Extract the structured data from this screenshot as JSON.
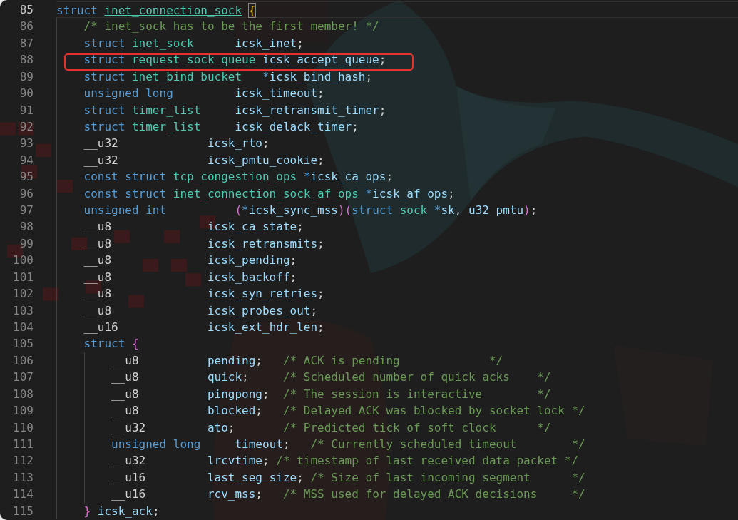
{
  "editor": {
    "lines": [
      {
        "number": "85",
        "current": true,
        "highlighted": false,
        "tokens": [
          {
            "text": "struct",
            "kind": "keyword"
          },
          {
            "text": " inet_connection_sock",
            "kind": "link"
          },
          {
            "text": " {",
            "kind": "bracket-match"
          }
        ]
      },
      {
        "number": "86",
        "current": false,
        "highlighted": false,
        "tokens": [
          {
            "text": "    /* inet_sock has to be the first member! */",
            "kind": "comment"
          }
        ]
      },
      {
        "number": "87",
        "current": false,
        "highlighted": false,
        "tokens": [
          {
            "text": "    struct",
            "kind": "keyword"
          },
          {
            "text": " inet_sock",
            "kind": "type"
          },
          {
            "text": "      icsk_inet",
            "kind": "variable"
          },
          {
            "text": ";",
            "kind": "plain"
          }
        ]
      },
      {
        "number": "88",
        "current": false,
        "highlighted": true,
        "tokens": [
          {
            "text": "    struct",
            "kind": "keyword"
          },
          {
            "text": " request_sock_queue",
            "kind": "type"
          },
          {
            "text": " icsk_accept_queue",
            "kind": "variable"
          },
          {
            "text": ";",
            "kind": "plain"
          }
        ]
      },
      {
        "number": "89",
        "current": false,
        "highlighted": false,
        "tokens": [
          {
            "text": "    struct",
            "kind": "keyword"
          },
          {
            "text": " inet_bind_bucket",
            "kind": "type"
          },
          {
            "text": "   *",
            "kind": "keyword"
          },
          {
            "text": "icsk_bind_hash",
            "kind": "variable"
          },
          {
            "text": ";",
            "kind": "plain"
          }
        ]
      },
      {
        "number": "90",
        "current": false,
        "highlighted": false,
        "tokens": [
          {
            "text": "    unsigned long",
            "kind": "keyword"
          },
          {
            "text": "         icsk_timeout",
            "kind": "variable"
          },
          {
            "text": ";",
            "kind": "plain"
          }
        ]
      },
      {
        "number": "91",
        "current": false,
        "highlighted": false,
        "tokens": [
          {
            "text": "    struct",
            "kind": "keyword"
          },
          {
            "text": " timer_list",
            "kind": "type"
          },
          {
            "text": "     icsk_retransmit_timer",
            "kind": "variable"
          },
          {
            "text": ";",
            "kind": "plain"
          }
        ]
      },
      {
        "number": "92",
        "current": false,
        "highlighted": false,
        "tokens": [
          {
            "text": "    struct",
            "kind": "keyword"
          },
          {
            "text": " timer_list",
            "kind": "type"
          },
          {
            "text": "     icsk_delack_timer",
            "kind": "variable"
          },
          {
            "text": ";",
            "kind": "plain"
          }
        ]
      },
      {
        "number": "93",
        "current": false,
        "highlighted": false,
        "tokens": [
          {
            "text": "    __u32",
            "kind": "plain"
          },
          {
            "text": "             icsk_rto",
            "kind": "variable"
          },
          {
            "text": ";",
            "kind": "plain"
          }
        ]
      },
      {
        "number": "94",
        "current": false,
        "highlighted": false,
        "tokens": [
          {
            "text": "    __u32",
            "kind": "plain"
          },
          {
            "text": "             icsk_pmtu_cookie",
            "kind": "variable"
          },
          {
            "text": ";",
            "kind": "plain"
          }
        ]
      },
      {
        "number": "95",
        "current": false,
        "highlighted": false,
        "tokens": [
          {
            "text": "    const struct",
            "kind": "keyword"
          },
          {
            "text": " tcp_congestion_ops",
            "kind": "type"
          },
          {
            "text": " *",
            "kind": "keyword"
          },
          {
            "text": "icsk_ca_ops",
            "kind": "variable"
          },
          {
            "text": ";",
            "kind": "plain"
          }
        ]
      },
      {
        "number": "96",
        "current": false,
        "highlighted": false,
        "tokens": [
          {
            "text": "    const struct",
            "kind": "keyword"
          },
          {
            "text": " inet_connection_sock_af_ops",
            "kind": "type"
          },
          {
            "text": " *",
            "kind": "keyword"
          },
          {
            "text": "icsk_af_ops",
            "kind": "variable"
          },
          {
            "text": ";",
            "kind": "plain"
          }
        ]
      },
      {
        "number": "97",
        "current": false,
        "highlighted": false,
        "tokens": [
          {
            "text": "    unsigned int",
            "kind": "keyword"
          },
          {
            "text": "          (",
            "kind": "bracket"
          },
          {
            "text": "*",
            "kind": "keyword"
          },
          {
            "text": "icsk_sync_mss",
            "kind": "variable"
          },
          {
            "text": ")(",
            "kind": "bracket"
          },
          {
            "text": "struct",
            "kind": "keyword"
          },
          {
            "text": " sock",
            "kind": "type"
          },
          {
            "text": " *",
            "kind": "keyword"
          },
          {
            "text": "sk",
            "kind": "variable"
          },
          {
            "text": ",",
            "kind": "plain"
          },
          {
            "text": " u32 pmtu",
            "kind": "variable"
          },
          {
            "text": ")",
            "kind": "bracket"
          },
          {
            "text": ";",
            "kind": "plain"
          }
        ]
      },
      {
        "number": "98",
        "current": false,
        "highlighted": false,
        "tokens": [
          {
            "text": "    __u8",
            "kind": "plain"
          },
          {
            "text": "              icsk_ca_state",
            "kind": "variable"
          },
          {
            "text": ";",
            "kind": "plain"
          }
        ]
      },
      {
        "number": "99",
        "current": false,
        "highlighted": false,
        "tokens": [
          {
            "text": "    __u8",
            "kind": "plain"
          },
          {
            "text": "              icsk_retransmits",
            "kind": "variable"
          },
          {
            "text": ";",
            "kind": "plain"
          }
        ]
      },
      {
        "number": "100",
        "current": false,
        "highlighted": false,
        "tokens": [
          {
            "text": "    __u8",
            "kind": "plain"
          },
          {
            "text": "              icsk_pending",
            "kind": "variable"
          },
          {
            "text": ";",
            "kind": "plain"
          }
        ]
      },
      {
        "number": "101",
        "current": false,
        "highlighted": false,
        "tokens": [
          {
            "text": "    __u8",
            "kind": "plain"
          },
          {
            "text": "              icsk_backoff",
            "kind": "variable"
          },
          {
            "text": ";",
            "kind": "plain"
          }
        ]
      },
      {
        "number": "102",
        "current": false,
        "highlighted": false,
        "tokens": [
          {
            "text": "    __u8",
            "kind": "plain"
          },
          {
            "text": "              icsk_syn_retries",
            "kind": "variable"
          },
          {
            "text": ";",
            "kind": "plain"
          }
        ]
      },
      {
        "number": "103",
        "current": false,
        "highlighted": false,
        "tokens": [
          {
            "text": "    __u8",
            "kind": "plain"
          },
          {
            "text": "              icsk_probes_out",
            "kind": "variable"
          },
          {
            "text": ";",
            "kind": "plain"
          }
        ]
      },
      {
        "number": "104",
        "current": false,
        "highlighted": false,
        "tokens": [
          {
            "text": "    __u16",
            "kind": "plain"
          },
          {
            "text": "             icsk_ext_hdr_len",
            "kind": "variable"
          },
          {
            "text": ";",
            "kind": "plain"
          }
        ]
      },
      {
        "number": "105",
        "current": false,
        "highlighted": false,
        "tokens": [
          {
            "text": "    struct",
            "kind": "keyword"
          },
          {
            "text": " {",
            "kind": "bracket"
          }
        ]
      },
      {
        "number": "106",
        "current": false,
        "highlighted": false,
        "tokens": [
          {
            "text": "        __u8",
            "kind": "plain"
          },
          {
            "text": "          pending",
            "kind": "variable"
          },
          {
            "text": ";",
            "kind": "plain"
          },
          {
            "text": "   /* ACK is pending             */",
            "kind": "comment"
          }
        ]
      },
      {
        "number": "107",
        "current": false,
        "highlighted": false,
        "tokens": [
          {
            "text": "        __u8",
            "kind": "plain"
          },
          {
            "text": "          quick",
            "kind": "variable"
          },
          {
            "text": ";",
            "kind": "plain"
          },
          {
            "text": "     /* Scheduled number of quick acks    */",
            "kind": "comment"
          }
        ]
      },
      {
        "number": "108",
        "current": false,
        "highlighted": false,
        "tokens": [
          {
            "text": "        __u8",
            "kind": "plain"
          },
          {
            "text": "          pingpong",
            "kind": "variable"
          },
          {
            "text": ";",
            "kind": "plain"
          },
          {
            "text": "  /* The session is interactive        */",
            "kind": "comment"
          }
        ]
      },
      {
        "number": "109",
        "current": false,
        "highlighted": false,
        "tokens": [
          {
            "text": "        __u8",
            "kind": "plain"
          },
          {
            "text": "          blocked",
            "kind": "variable"
          },
          {
            "text": ";",
            "kind": "plain"
          },
          {
            "text": "   /* Delayed ACK was blocked by socket lock */",
            "kind": "comment"
          }
        ]
      },
      {
        "number": "110",
        "current": false,
        "highlighted": false,
        "tokens": [
          {
            "text": "        __u32",
            "kind": "plain"
          },
          {
            "text": "         ato",
            "kind": "variable"
          },
          {
            "text": ";",
            "kind": "plain"
          },
          {
            "text": "       /* Predicted tick of soft clock      */",
            "kind": "comment"
          }
        ]
      },
      {
        "number": "111",
        "current": false,
        "highlighted": false,
        "tokens": [
          {
            "text": "        unsigned long",
            "kind": "keyword"
          },
          {
            "text": "     timeout",
            "kind": "variable"
          },
          {
            "text": ";",
            "kind": "plain"
          },
          {
            "text": "   /* Currently scheduled timeout        */",
            "kind": "comment"
          }
        ]
      },
      {
        "number": "112",
        "current": false,
        "highlighted": false,
        "tokens": [
          {
            "text": "        __u32",
            "kind": "plain"
          },
          {
            "text": "         lrcvtime",
            "kind": "variable"
          },
          {
            "text": ";",
            "kind": "plain"
          },
          {
            "text": " /* timestamp of last received data packet */",
            "kind": "comment"
          }
        ]
      },
      {
        "number": "113",
        "current": false,
        "highlighted": false,
        "tokens": [
          {
            "text": "        __u16",
            "kind": "plain"
          },
          {
            "text": "         last_seg_size",
            "kind": "variable"
          },
          {
            "text": ";",
            "kind": "plain"
          },
          {
            "text": " /* Size of last incoming segment      */",
            "kind": "comment"
          }
        ]
      },
      {
        "number": "114",
        "current": false,
        "highlighted": false,
        "tokens": [
          {
            "text": "        __u16",
            "kind": "plain"
          },
          {
            "text": "         rcv_mss",
            "kind": "variable"
          },
          {
            "text": ";",
            "kind": "plain"
          },
          {
            "text": "   /* MSS used for delayed ACK decisions     */",
            "kind": "comment"
          }
        ]
      },
      {
        "number": "115",
        "current": false,
        "highlighted": false,
        "tokens": [
          {
            "text": "    }",
            "kind": "bracket"
          },
          {
            "text": " icsk_ack",
            "kind": "variable"
          },
          {
            "text": ";",
            "kind": "plain"
          }
        ]
      }
    ]
  }
}
